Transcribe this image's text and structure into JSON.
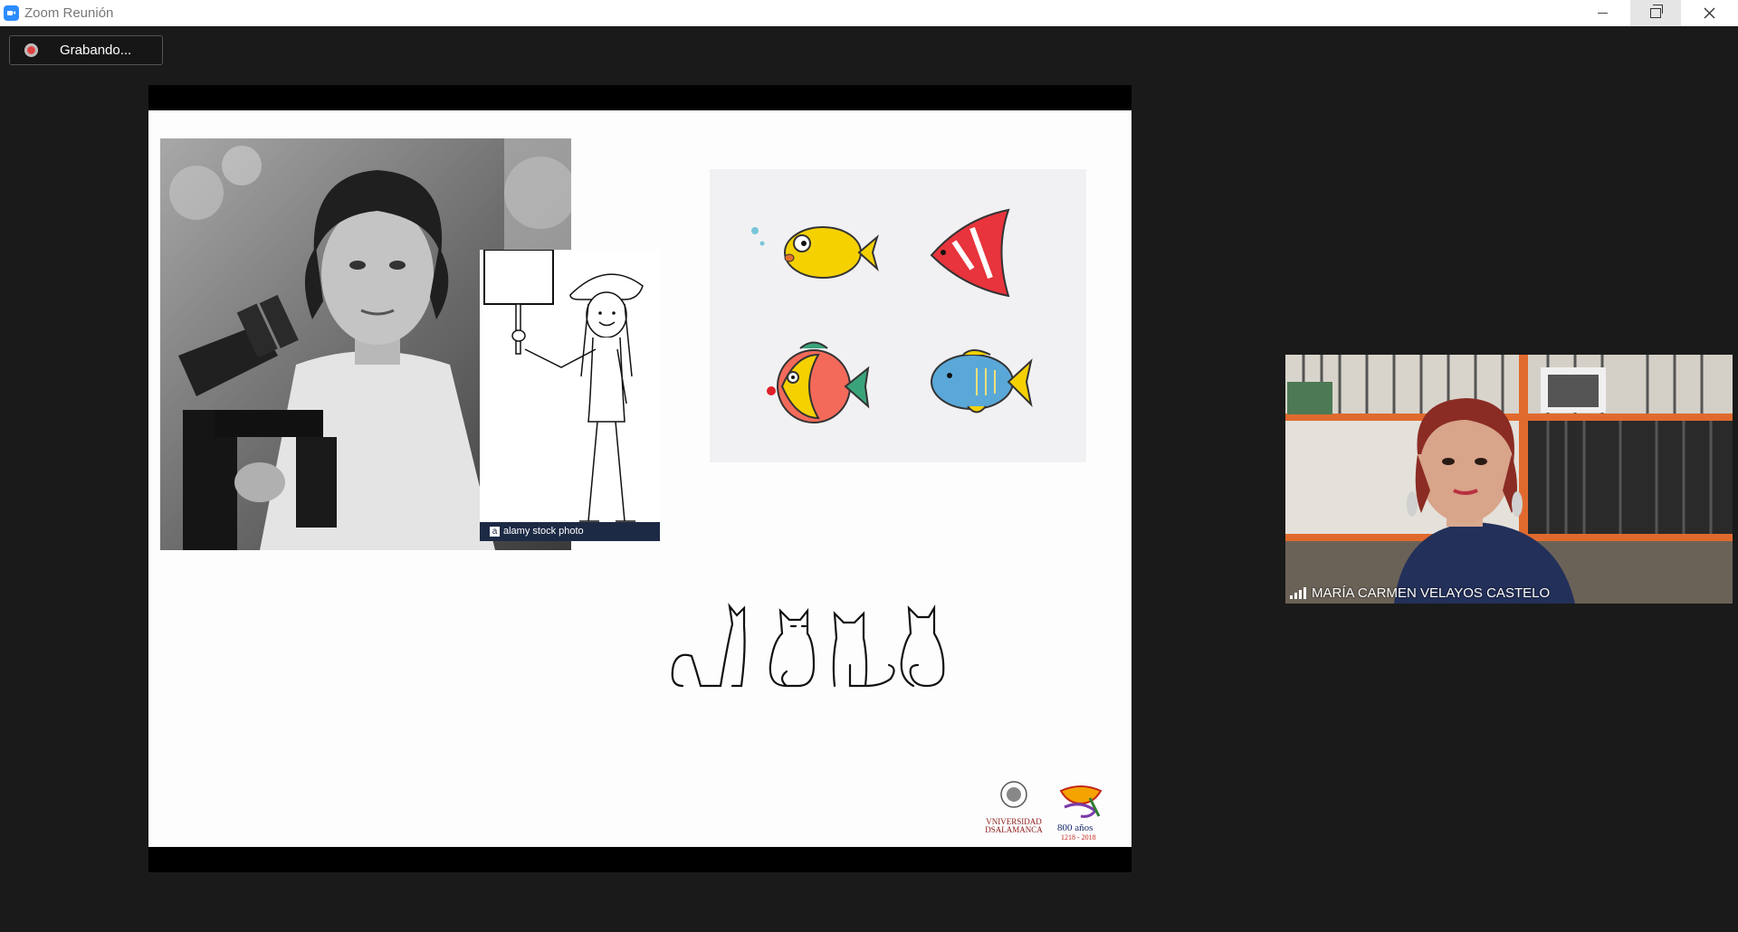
{
  "window": {
    "title": "Zoom Reunión",
    "controls": [
      "minimize",
      "restore",
      "close"
    ]
  },
  "recording": {
    "label": "Grabando..."
  },
  "slide": {
    "stock_watermark": "alamy stock photo",
    "logo_university": "VNIVERSIDAD DSALAMANCA",
    "logo_anniversary_top": "800 años",
    "logo_anniversary_years": "1218 - 2018"
  },
  "participant": {
    "name": "MARÍA CARMEN VELAYOS CASTELO"
  },
  "colors": {
    "background": "#1a1a1a",
    "recording_dot": "#e2514a",
    "zoom_blue": "#2d8cff"
  }
}
